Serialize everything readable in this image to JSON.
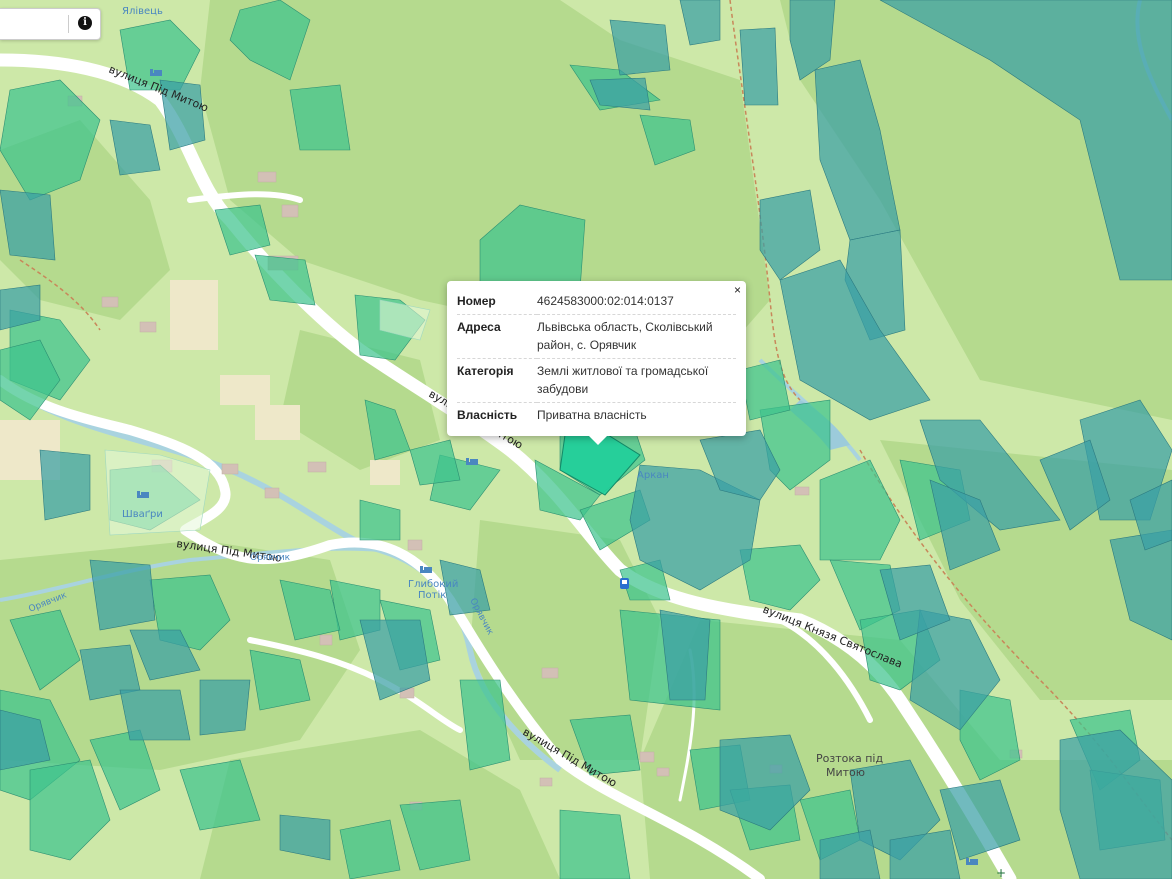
{
  "search": {
    "info_icon": "info-circle-icon"
  },
  "popup": {
    "close_label": "×",
    "rows": [
      {
        "key": "Номер",
        "value": "4624583000:02:014:0137"
      },
      {
        "key": "Адреса",
        "value": "Львівська область, Сколівський район, с. Орявчик"
      },
      {
        "key": "Категорія",
        "value": "Землі житлової та громадської забудови"
      },
      {
        "key": "Власність",
        "value": "Приватна власність"
      }
    ]
  },
  "labels": {
    "street_1": "вулиця Під Митою",
    "street_2": "вулиця Під Митою",
    "street_3": "вулиця Під Митою",
    "street_4": "вулиця Під Митою",
    "street_5": "вулиця Князя Святослава",
    "village_1": "Ялівець",
    "village_2": "Шваґри",
    "village_3": "Глибокий",
    "village_3b": "Потік",
    "place_1": "Розтока під",
    "place_1b": "Митою",
    "place_2": "Аркан",
    "stream_1": "Орявчик",
    "stream_2": "Орявчик",
    "stream_3": "Орявчик"
  },
  "colors": {
    "land": "#cde8a8",
    "forest": "#b3d98a",
    "parcel_green": "#3ec48e",
    "parcel_teal": "#3a9fa5",
    "road": "#ffffff",
    "water": "#a9d3df",
    "selected": "#1fcf9a"
  }
}
